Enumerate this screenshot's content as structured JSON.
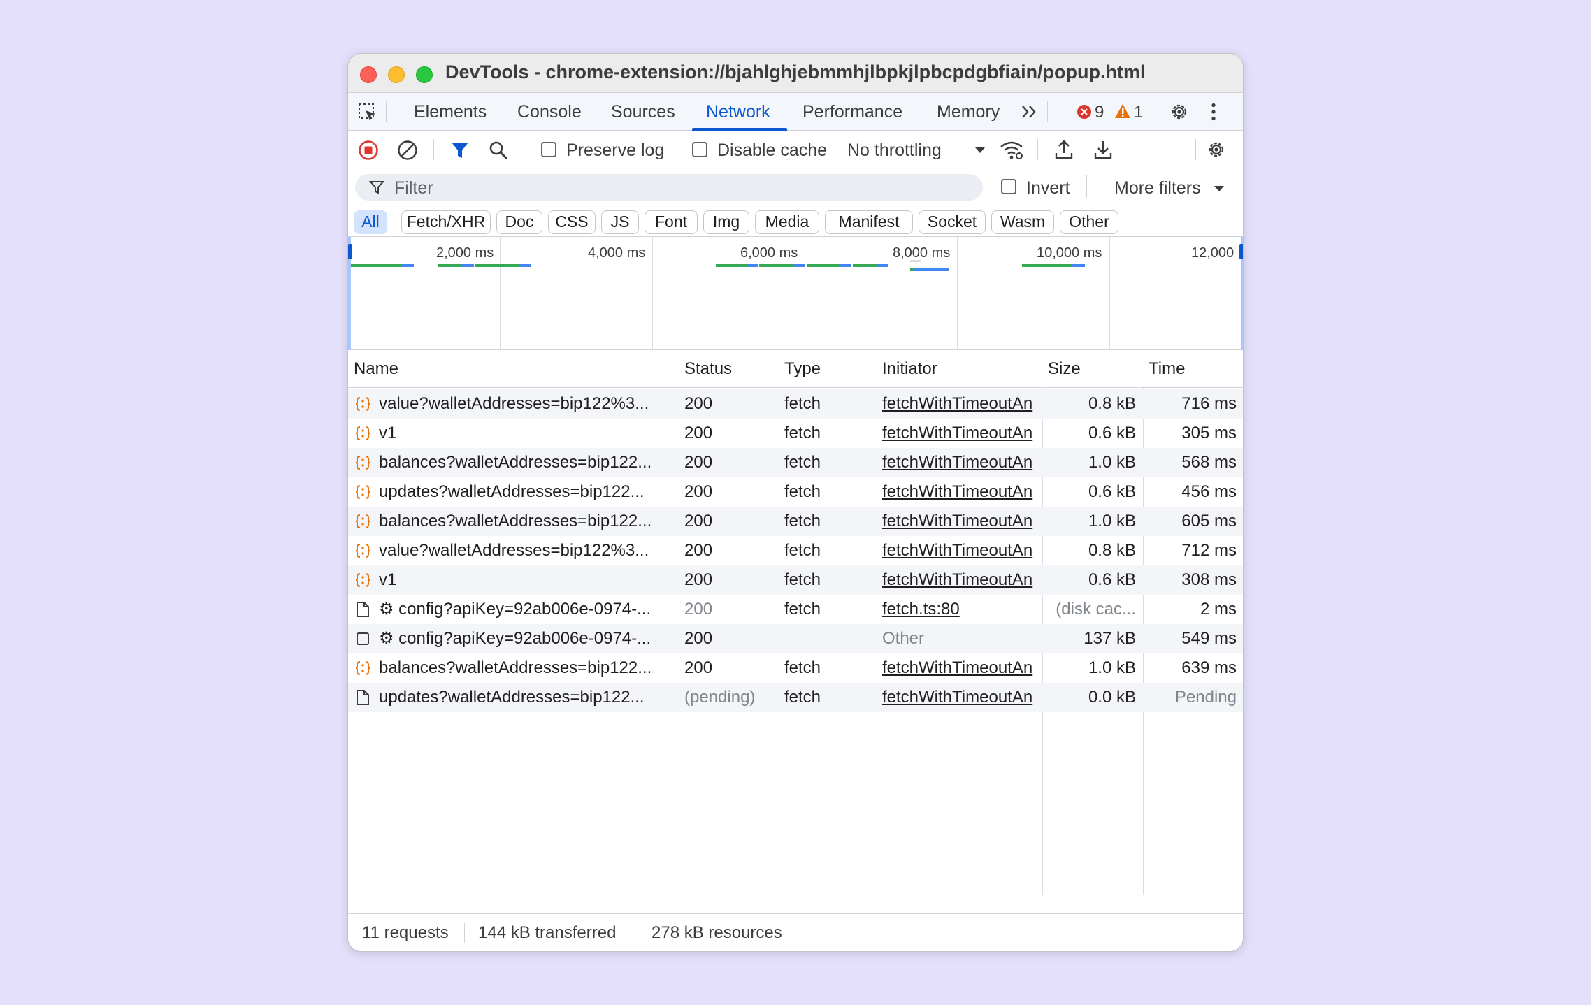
{
  "window": {
    "title": "DevTools - chrome-extension://bjahlghjebmmhjlbpkjlpbcpdgbfiain/popup.html"
  },
  "tabs": [
    {
      "label": "Elements"
    },
    {
      "label": "Console"
    },
    {
      "label": "Sources"
    },
    {
      "label": "Network",
      "active": true
    },
    {
      "label": "Performance"
    },
    {
      "label": "Memory"
    }
  ],
  "badges": {
    "errors": "9",
    "warnings": "1"
  },
  "toolbar": {
    "preserve_log_label": "Preserve log",
    "disable_cache_label": "Disable cache",
    "throttling_value": "No throttling"
  },
  "filter": {
    "placeholder": "Filter",
    "invert_label": "Invert",
    "more_filters_label": "More filters"
  },
  "type_filters": [
    "All",
    "Fetch/XHR",
    "Doc",
    "CSS",
    "JS",
    "Font",
    "Img",
    "Media",
    "Manifest",
    "Socket",
    "Wasm",
    "Other"
  ],
  "timeline": {
    "labels": [
      "2,000 ms",
      "4,000 ms",
      "6,000 ms",
      "8,000 ms",
      "10,000 ms",
      "12,000"
    ]
  },
  "table": {
    "headers": {
      "name": "Name",
      "status": "Status",
      "type": "Type",
      "initiator": "Initiator",
      "size": "Size",
      "time": "Time"
    },
    "rows": [
      {
        "icon": "fetch-icon",
        "name": "value?walletAddresses=bip122%3...",
        "status": "200",
        "type": "fetch",
        "initiator": "fetchWithTimeoutAn",
        "size": "0.8 kB",
        "time": "716 ms"
      },
      {
        "icon": "fetch-icon",
        "name": "v1",
        "status": "200",
        "type": "fetch",
        "initiator": "fetchWithTimeoutAn",
        "size": "0.6 kB",
        "time": "305 ms"
      },
      {
        "icon": "fetch-icon",
        "name": "balances?walletAddresses=bip122...",
        "status": "200",
        "type": "fetch",
        "initiator": "fetchWithTimeoutAn",
        "size": "1.0 kB",
        "time": "568 ms"
      },
      {
        "icon": "fetch-icon",
        "name": "updates?walletAddresses=bip122...",
        "status": "200",
        "type": "fetch",
        "initiator": "fetchWithTimeoutAn",
        "size": "0.6 kB",
        "time": "456 ms"
      },
      {
        "icon": "fetch-icon",
        "name": "balances?walletAddresses=bip122...",
        "status": "200",
        "type": "fetch",
        "initiator": "fetchWithTimeoutAn",
        "size": "1.0 kB",
        "time": "605 ms"
      },
      {
        "icon": "fetch-icon",
        "name": "value?walletAddresses=bip122%3...",
        "status": "200",
        "type": "fetch",
        "initiator": "fetchWithTimeoutAn",
        "size": "0.8 kB",
        "time": "712 ms"
      },
      {
        "icon": "fetch-icon",
        "name": "v1",
        "status": "200",
        "type": "fetch",
        "initiator": "fetchWithTimeoutAn",
        "size": "0.6 kB",
        "time": "308 ms"
      },
      {
        "icon": "document-icon",
        "name": "⚙ config?apiKey=92ab006e-0974-...",
        "status": "200",
        "type": "fetch",
        "initiator": "fetch.ts:80",
        "size": "(disk cac...",
        "time": "2 ms",
        "muted_status": true,
        "muted_size": true
      },
      {
        "icon": "blank-icon",
        "name": "⚙ config?apiKey=92ab006e-0974-...",
        "status": "200",
        "type": "",
        "initiator": "Other",
        "size": "137 kB",
        "time": "549 ms",
        "muted_initiator": true
      },
      {
        "icon": "fetch-icon",
        "name": "balances?walletAddresses=bip122...",
        "status": "200",
        "type": "fetch",
        "initiator": "fetchWithTimeoutAn",
        "size": "1.0 kB",
        "time": "639 ms"
      },
      {
        "icon": "document-icon",
        "name": "updates?walletAddresses=bip122...",
        "status": "(pending)",
        "type": "fetch",
        "initiator": "fetchWithTimeoutAn",
        "size": "0.0 kB",
        "time": "Pending",
        "muted_status": true,
        "muted_time": true
      }
    ]
  },
  "statusbar": {
    "requests": "11 requests",
    "transferred": "144 kB transferred",
    "resources": "278 kB resources"
  },
  "colors": {
    "accent": "#0b57d0",
    "highlight_box": "#e8131c",
    "fetch_icon": "#e8710a",
    "timeline_green": "#34a853",
    "timeline_blue": "#4285f4",
    "error_badge": "#dc362e",
    "warning_badge": "#e8710a"
  }
}
